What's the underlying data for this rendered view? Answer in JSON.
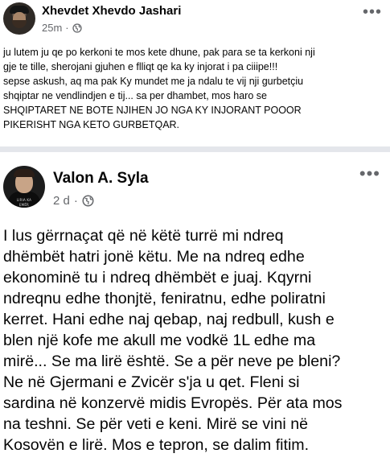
{
  "post1": {
    "author": "Xhevdet Xhevdo Jashari",
    "time": "25m",
    "separator": "·",
    "privacy_icon": "globe-icon",
    "menu_icon": "more-options-icon",
    "lines": [
      "ju lutem ju qe po kerkoni te mos kete dhune, pak para se ta kerkoni nji",
      "gje te tille, sherojani gjuhen e flliqt qe ka ky injorat i pa ciiipe!!!",
      "sepse askush, aq ma pak Ky mundet me ja ndalu te vij nji gurbetçiu",
      "shqiptar ne vendlindjen e tij... sa per dhambet, mos haro se",
      "SHQIPTARET NE BOTE NJIHEN JO NGA KY INJORANT POOOR",
      "PIKERISHT NGA KETO GURBETQAR."
    ]
  },
  "post2": {
    "author": "Valon A. Syla",
    "time": "2 d",
    "separator": "·",
    "privacy_icon": "globe-icon",
    "menu_icon": "more-options-icon",
    "avatar_caption": "LIRIA KA EMËR",
    "lines": [
      "I lus gërrnaçat që në këtë turrë mi ndreq",
      "dhëmbët hatri jonë këtu. Me na ndreq edhe",
      "ekonominë tu i ndreq dhëmbët e juaj. Kqyrni",
      "ndreqnu edhe thonjtë, feniratnu, edhe poliratni",
      "kerret. Hani edhe naj qebap, naj redbull, kush e",
      "blen një kofe me akull me vodkë 1L edhe ma",
      "mirë... Se ma lirë është. Se a për neve pe bleni?",
      "Ne në Gjermani e Zvicër s'ja u qet. Fleni si",
      "sardina në konzervë midis Evropës. Për ata mos",
      "na teshni. Se për veti e keni. Mirë se vini në",
      "Kosovën e lirë. Mos e tepron, se dalim fitim."
    ]
  }
}
